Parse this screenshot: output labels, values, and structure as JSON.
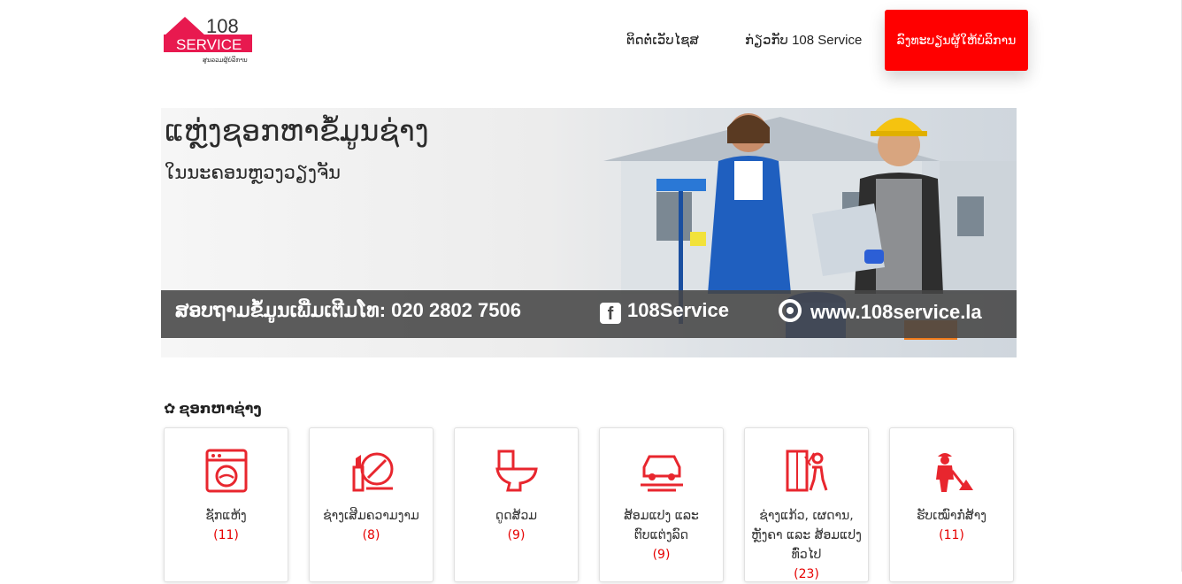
{
  "header": {
    "logo": {
      "number": "108",
      "word": "SERVICE",
      "tagline": "ສູນລວມຜູ້ບໍລິການ"
    },
    "nav": [
      {
        "label": "ຕິດຕໍ່ເວັບໄຊສ"
      },
      {
        "label": "ກ່ຽວກັບ 108 Service"
      }
    ],
    "register_button": "ລົງທະບຽນຜູ້ໃຫ້ບໍລິການ"
  },
  "banner": {
    "title": "ແຫຼ່ງຊອກຫາຂໍ້ມູນຊ່າງ",
    "subtitle": "ໃນນະຄອນຫຼວງວຽງຈັນ",
    "contact_line": "ສອບຖາມຂໍ້ມູນເພີ່ມເຕີມໂທ: 020 2802 7506",
    "facebook": "108Service",
    "website": "www.108service.la",
    "icons": [
      "facebook-icon",
      "chrome-icon"
    ]
  },
  "section": {
    "title": "ຊອກຫາຊ່າງ",
    "icon": "gear-icon"
  },
  "categories": [
    {
      "label": "ຊັກແຫ້ງ",
      "count": "(11)",
      "icon": "washing-machine-icon"
    },
    {
      "label": "ຊ່າງເສີມຄວາມງາມ",
      "count": "(8)",
      "icon": "makeup-icon"
    },
    {
      "label": "ດູດສ້ວມ",
      "count": "(9)",
      "icon": "toilet-icon"
    },
    {
      "label": "ສ້ອມແປງ ແລະ ຕົບແຕ່ງລົດ",
      "count": "(9)",
      "icon": "car-repair-icon"
    },
    {
      "label": "ຊ່າງແກ້ວ, ເຜດານ, ຫຼັງຄາ ແລະ ສ້ອມແປງທົ່ວໄປ",
      "count": "(23)",
      "icon": "glass-repair-icon"
    },
    {
      "label": "ຮັບເໝົາກໍ່ສ້າງ",
      "count": "(11)",
      "icon": "construction-worker-icon"
    }
  ],
  "colors": {
    "accent": "#ff0000",
    "logo_pink": "#e8194f",
    "count": "#e60000"
  }
}
